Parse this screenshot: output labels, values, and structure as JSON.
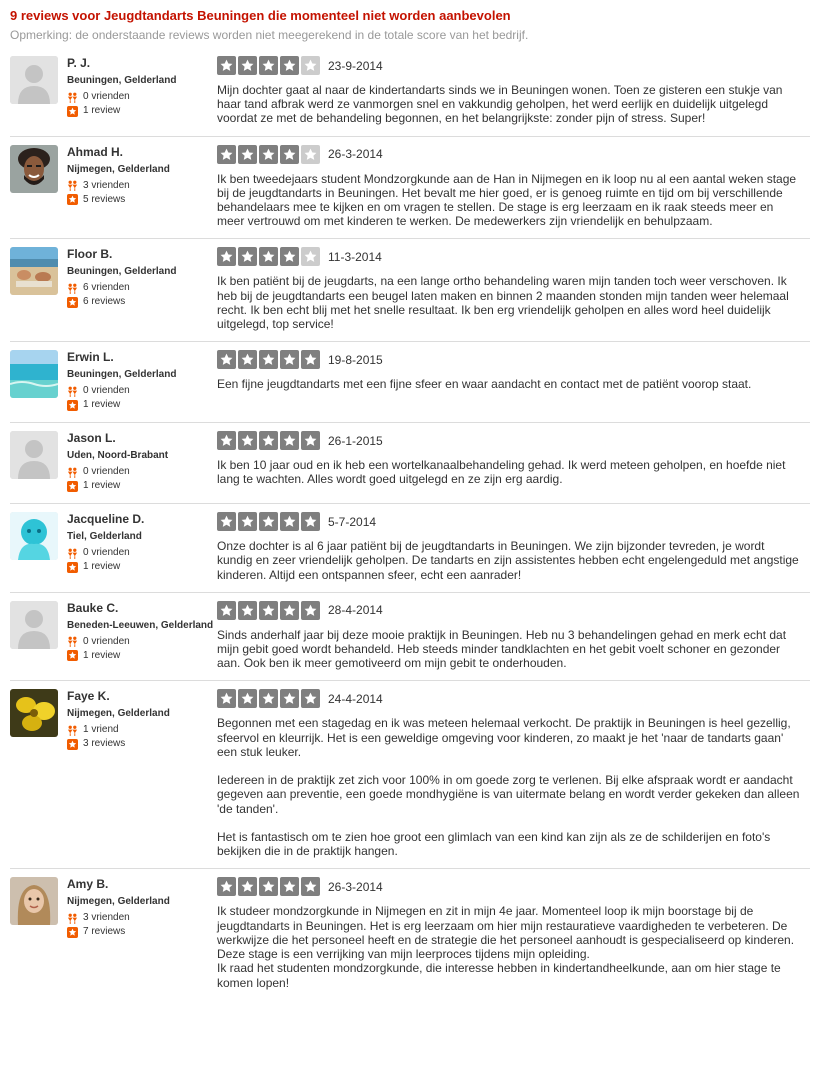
{
  "page": {
    "heading": "9 reviews voor Jeugdtandarts Beuningen die momenteel niet worden aanbevolen",
    "note": "Opmerking: de onderstaande reviews worden niet meegerekend in de totale score van het bedrijf."
  },
  "colors": {
    "heading": "#c41200",
    "star_on": "#7f7f7f",
    "star_off": "#cccccc",
    "badge": "#f15c00"
  },
  "icons": {
    "friends": "friends-icon",
    "reviews": "review-star-badge-icon",
    "star": "star-icon"
  },
  "reviews": [
    {
      "name": "P. J.",
      "location": "Beuningen, Gelderland",
      "friends": "0 vrienden",
      "review_count": "1 review",
      "rating": 4,
      "date": "23-9-2014",
      "avatar": "default",
      "text": "Mijn dochter gaat al naar de kindertandarts sinds we in Beuningen wonen. Toen ze gisteren een stukje van haar tand afbrak werd ze vanmorgen snel en vakkundig geholpen, het werd eerlijk en duidelijk uitgelegd voordat ze met de behandeling begonnen, en het belangrijkste: zonder pijn of stress. Super!"
    },
    {
      "name": "Ahmad H.",
      "location": "Nijmegen, Gelderland",
      "friends": "3 vrienden",
      "review_count": "5 reviews",
      "rating": 4,
      "date": "26-3-2014",
      "avatar": "man",
      "text": "Ik ben tweedejaars student Mondzorgkunde aan de Han in Nijmegen en ik loop nu al een aantal weken stage bij de jeugdtandarts in Beuningen. Het bevalt me hier goed, er is genoeg ruimte en tijd om bij verschillende behandelaars mee te kijken en om vragen te stellen. De stage is erg leerzaam en ik raak steeds meer en meer vertrouwd om met kinderen te werken. De medewerkers zijn vriendelijk en behulpzaam."
    },
    {
      "name": "Floor B.",
      "location": "Beuningen, Gelderland",
      "friends": "6 vrienden",
      "review_count": "6 reviews",
      "rating": 4,
      "date": "11-3-2014",
      "avatar": "beach",
      "text": "Ik ben patiënt bij de jeugdarts, na een lange ortho behandeling waren mijn tanden toch weer verschoven. Ik heb bij de jeugdtandarts een beugel laten maken en binnen 2 maanden stonden mijn tanden weer helemaal recht. Ik ben echt blij met het snelle resultaat. Ik ben erg vriendelijk geholpen en alles word heel duidelijk uitgelegd, top service!"
    },
    {
      "name": "Erwin L.",
      "location": "Beuningen, Gelderland",
      "friends": "0 vrienden",
      "review_count": "1 review",
      "rating": 5,
      "date": "19-8-2015",
      "avatar": "sea",
      "text": "Een fijne jeugdtandarts met een fijne sfeer en waar aandacht en contact met de patiënt voorop staat."
    },
    {
      "name": "Jason L.",
      "location": "Uden, Noord-Brabant",
      "friends": "0 vrienden",
      "review_count": "1 review",
      "rating": 5,
      "date": "26-1-2015",
      "avatar": "default",
      "text": "Ik ben 10 jaar oud en ik heb een wortelkanaalbehandeling gehad. Ik werd meteen geholpen, en hoefde niet lang te wachten. Alles wordt goed uitgelegd en ze zijn erg aardig."
    },
    {
      "name": "Jacqueline D.",
      "location": "Tiel, Gelderland",
      "friends": "0 vrienden",
      "review_count": "1 review",
      "rating": 5,
      "date": "5-7-2014",
      "avatar": "cyan",
      "text": "Onze dochter is al 6 jaar patiënt bij de jeugdtandarts in Beuningen. We zijn bijzonder tevreden, je wordt kundig en zeer vriendelijk geholpen. De tandarts en zijn assistentes hebben echt engelengeduld met angstige kinderen. Altijd een ontspannen sfeer, echt een aanrader!"
    },
    {
      "name": "Bauke C.",
      "location": "Beneden-Leeuwen, Gelderland",
      "friends": "0 vrienden",
      "review_count": "1 review",
      "rating": 5,
      "date": "28-4-2014",
      "avatar": "default",
      "text": "Sinds anderhalf jaar bij deze mooie praktijk in Beuningen. Heb nu 3 behandelingen gehad en merk echt dat mijn gebit goed wordt behandeld. Heb steeds minder tandklachten en het gebit voelt schoner en gezonder aan. Ook ben ik meer gemotiveerd om mijn gebit te onderhouden."
    },
    {
      "name": "Faye K.",
      "location": "Nijmegen, Gelderland",
      "friends": "1 vriend",
      "review_count": "3 reviews",
      "rating": 5,
      "date": "24-4-2014",
      "avatar": "flower",
      "text": "Begonnen met een stagedag en ik was meteen helemaal verkocht. De praktijk in Beuningen is heel gezellig, sfeervol en kleurrijk. Het is een geweldige omgeving voor kinderen, zo maakt je het 'naar de tandarts gaan' een stuk leuker.\n\nIedereen in de praktijk zet zich voor 100% in om goede zorg te verlenen. Bij elke afspraak wordt er aandacht gegeven aan preventie, een goede mondhygiëne is van uitermate belang en wordt verder gekeken dan alleen 'de tanden'.\n\nHet is fantastisch om te zien hoe groot een glimlach van een kind kan zijn als ze de schilderijen en foto's bekijken die in de praktijk hangen."
    },
    {
      "name": "Amy B.",
      "location": "Nijmegen, Gelderland",
      "friends": "3 vrienden",
      "review_count": "7 reviews",
      "rating": 5,
      "date": "26-3-2014",
      "avatar": "woman",
      "text": "Ik studeer mondzorgkunde in Nijmegen en zit in mijn 4e jaar. Momenteel loop ik mijn boorstage bij de jeugdtandarts in Beuningen.  Het is erg leerzaam om hier mijn restauratieve vaardigheden te verbeteren. De werkwijze die het personeel heeft en de strategie die het personeel aanhoudt is gespecialiseerd op kinderen. Deze stage is een verrijking van mijn leerproces tijdens mijn opleiding.\nIk raad het studenten mondzorgkunde, die interesse hebben in kindertandheelkunde, aan om hier stage te komen lopen!"
    }
  ]
}
